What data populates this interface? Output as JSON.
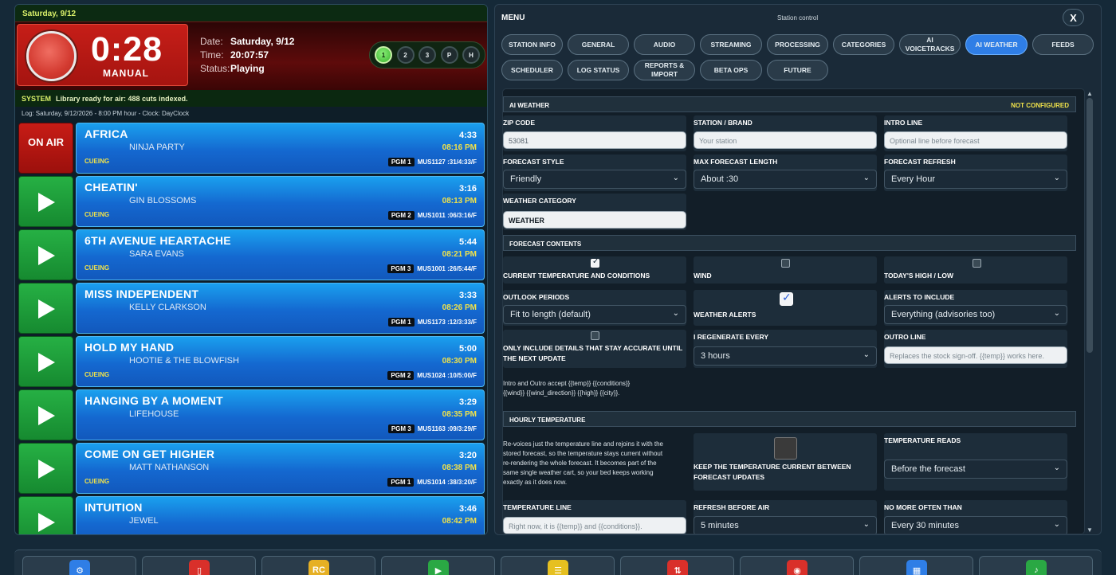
{
  "date_header": "Saturday, 9/12",
  "counter": {
    "time": "0:28",
    "mode": "MANUAL"
  },
  "info": {
    "date_label": "Date:",
    "date": "Saturday, 9/12",
    "time_label": "Time:",
    "time": "20:07:57",
    "status_label": "Status:",
    "status": "Playing"
  },
  "pills": [
    "1",
    "2",
    "3",
    "P",
    "H"
  ],
  "system": {
    "tag": "SYSTEM",
    "message": "Library ready for air: 488 cuts indexed."
  },
  "log_line": "Log: Saturday, 9/12/2026 - 8:00 PM hour - Clock: DayClock",
  "on_air_label": "ON AIR",
  "carts": [
    {
      "title": "AFRICA",
      "artist": "NINJA PARTY",
      "length": "4:33",
      "time": "08:16 PM",
      "status": "CUEING",
      "pgm": "PGM 1",
      "code": "MUS1127 :31/4:33/F"
    },
    {
      "title": "CHEATIN'",
      "artist": "GIN BLOSSOMS",
      "length": "3:16",
      "time": "08:13 PM",
      "status": "CUEING",
      "pgm": "PGM 2",
      "code": "MUS1011 :06/3:16/F"
    },
    {
      "title": "6TH AVENUE HEARTACHE",
      "artist": "SARA EVANS",
      "length": "5:44",
      "time": "08:21 PM",
      "status": "CUEING",
      "pgm": "PGM 3",
      "code": "MUS1001 :26/5:44/F"
    },
    {
      "title": "MISS INDEPENDENT",
      "artist": "KELLY CLARKSON",
      "length": "3:33",
      "time": "08:26 PM",
      "status": "",
      "pgm": "PGM 1",
      "code": "MUS1173 :12/3:33/F"
    },
    {
      "title": "HOLD MY HAND",
      "artist": "HOOTIE & THE BLOWFISH",
      "length": "5:00",
      "time": "08:30 PM",
      "status": "CUEING",
      "pgm": "PGM 2",
      "code": "MUS1024 :10/5:00/F"
    },
    {
      "title": "HANGING BY A MOMENT",
      "artist": "LIFEHOUSE",
      "length": "3:29",
      "time": "08:35 PM",
      "status": "",
      "pgm": "PGM 3",
      "code": "MUS1163 :09/3:29/F"
    },
    {
      "title": "COME ON GET HIGHER",
      "artist": "MATT NATHANSON",
      "length": "3:20",
      "time": "08:38 PM",
      "status": "CUEING",
      "pgm": "PGM 1",
      "code": "MUS1014 :38/3:20/F"
    },
    {
      "title": "INTUITION",
      "artist": "JEWEL",
      "length": "3:46",
      "time": "08:42 PM",
      "status": "",
      "pgm": "",
      "code": ""
    }
  ],
  "menu": {
    "title": "MENU",
    "subtitle": "Station control",
    "close": "X"
  },
  "tabs_row1": [
    "STATION INFO",
    "GENERAL",
    "AUDIO",
    "STREAMING",
    "PROCESSING",
    "CATEGORIES",
    "AI VOICETRACKS",
    "AI WEATHER",
    "FEEDS"
  ],
  "tabs_row2": [
    "SCHEDULER",
    "LOG STATUS",
    "REPORTS & IMPORT",
    "BETA OPS",
    "FUTURE"
  ],
  "section": {
    "title": "AI WEATHER",
    "status": "NOT CONFIGURED"
  },
  "fields": {
    "zip_label": "ZIP CODE",
    "zip_value": "53081",
    "station_label": "STATION / BRAND",
    "station_placeholder": "Your station",
    "intro_label": "INTRO LINE",
    "intro_placeholder": "Optional line before forecast",
    "style_label": "FORECAST STYLE",
    "style_value": "Friendly",
    "maxlen_label": "MAX FORECAST LENGTH",
    "maxlen_value": "About :30",
    "refresh_label": "FORECAST REFRESH",
    "refresh_value": "Every Hour",
    "category_label": "WEATHER CATEGORY",
    "category_value": "WEATHER"
  },
  "contents": {
    "header": "FORECAST CONTENTS",
    "current_temp": "CURRENT TEMPERATURE AND CONDITIONS",
    "wind": "WIND",
    "high_low": "TODAY'S HIGH / LOW",
    "outlook_label": "OUTLOOK PERIODS",
    "outlook_value": "Fit to length (default)",
    "alerts": "WEATHER ALERTS",
    "alerts_include_label": "ALERTS TO INCLUDE",
    "alerts_include_value": "Everything (advisories too)",
    "accurate": "ONLY INCLUDE DETAILS THAT STAY ACCURATE UNTIL THE NEXT UPDATE",
    "regen_label": "I REGENERATE EVERY",
    "regen_value": "3 hours",
    "outro_label": "OUTRO LINE",
    "outro_placeholder": "Replaces the stock sign-off. {{temp}} works here.",
    "help1": "Intro and Outro accept {{temp}} {{conditions}}",
    "help2": "{{wind}} {{wind_direction}} {{high}} {{city}}."
  },
  "hourly": {
    "header": "HOURLY TEMPERATURE",
    "desc": [
      "Re-voices just the temperature line and rejoins it with the",
      "stored forecast, so the temperature stays current without",
      "re-rendering the whole forecast. It becomes part of the",
      "same single weather cart, so your bed keeps working",
      "exactly as it does now."
    ],
    "keep": "KEEP THE TEMPERATURE CURRENT BETWEEN FORECAST UPDATES",
    "reads_label": "TEMPERATURE READS",
    "reads_value": "Before the forecast",
    "line_label": "TEMPERATURE LINE",
    "line_value": "Right now, it is {{temp}} and {{conditions}}.",
    "before_label": "REFRESH BEFORE AIR",
    "before_value": "5 minutes",
    "often_label": "NO MORE OFTEN THAN",
    "often_value": "Every 30 minutes"
  },
  "footer": [
    {
      "icon": "gear-icon",
      "label": "⚙",
      "color": "#2f7ee6"
    },
    {
      "icon": "phone-icon",
      "label": "▯",
      "color": "#d9302a"
    },
    {
      "icon": "rc-icon",
      "label": "RC",
      "color": "#e6b024"
    },
    {
      "icon": "play-icon",
      "label": "▶",
      "color": "#2aa844"
    },
    {
      "icon": "notes-icon",
      "label": "☰",
      "color": "#e6c020"
    },
    {
      "icon": "sort-icon",
      "label": "⇅",
      "color": "#d9302a"
    },
    {
      "icon": "record-icon",
      "label": "◉",
      "color": "#d9302a"
    },
    {
      "icon": "grid-icon",
      "label": "▦",
      "color": "#2f7ee6"
    },
    {
      "icon": "music-icon",
      "label": "♪",
      "color": "#2aa844"
    }
  ]
}
